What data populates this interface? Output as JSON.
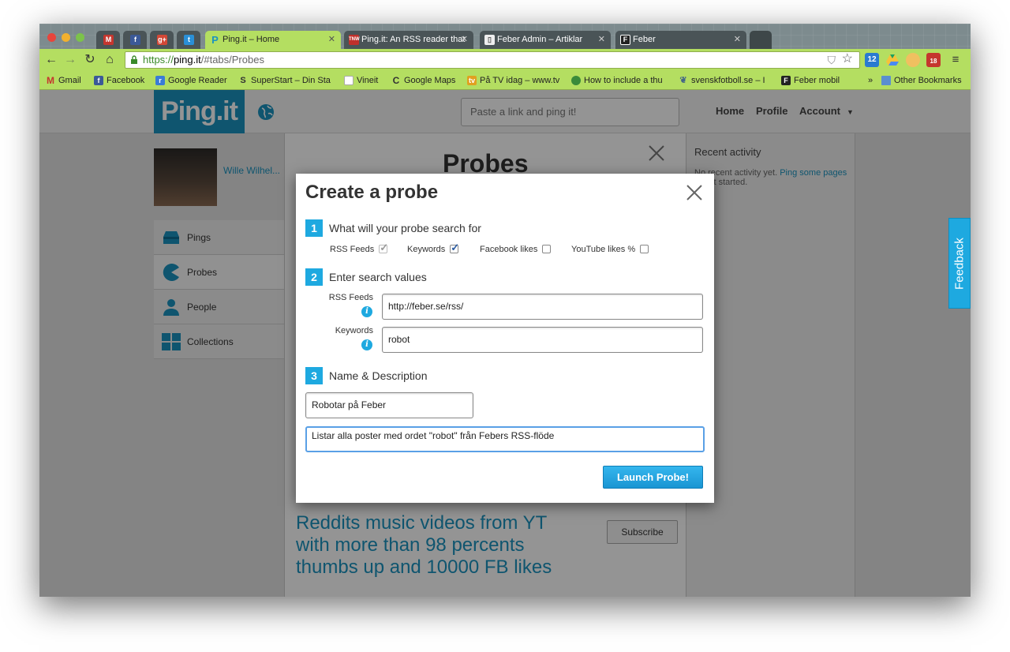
{
  "browser": {
    "tabs": [
      {
        "label": "",
        "icon": "gmail-icon",
        "color": "#c5362e"
      },
      {
        "label": "",
        "icon": "facebook-icon",
        "color": "#3b5998"
      },
      {
        "label": "",
        "icon": "google-plus-icon",
        "color": "#d34836"
      },
      {
        "label": "",
        "icon": "twitter-icon",
        "color": "#2a8fd6"
      },
      {
        "label": "Ping.it – Home",
        "icon": "pingit-icon",
        "color": "#1b93bf"
      },
      {
        "label": "Ping.it: An RSS reader that",
        "icon": "tnw-icon",
        "color": "#c0302b"
      },
      {
        "label": "Feber Admin – Artiklar",
        "icon": "document-icon",
        "color": "#eeeeee"
      },
      {
        "label": "Feber",
        "icon": "feber-icon",
        "color": "#222222"
      }
    ],
    "url_prefix": "https://",
    "url_host": "ping.it",
    "url_path": "/#tabs/Probes",
    "bookmarks": [
      {
        "label": "Gmail",
        "color": "#c5362e"
      },
      {
        "label": "Facebook",
        "color": "#3b5998"
      },
      {
        "label": "Google Reader",
        "color": "#3a7cd6"
      },
      {
        "label": "SuperStart – Din Sta",
        "color": "#333333"
      },
      {
        "label": "Vineit",
        "color": "#dddddd"
      },
      {
        "label": "Google Maps",
        "color": "#4a8a3a"
      },
      {
        "label": "På TV idag – www.tv",
        "color": "#e0a020"
      },
      {
        "label": "How to include a thu",
        "color": "#3a8a3a"
      },
      {
        "label": "svenskfotboll.se – I",
        "color": "#446688"
      },
      {
        "label": "Feber mobil",
        "color": "#222222"
      },
      {
        "label": "Other Bookmarks",
        "color": "#5a8fd0"
      }
    ],
    "bookmarks_overflow": "»",
    "extensions_badge": "12",
    "mail_badge": "18"
  },
  "header": {
    "logo": "Ping.it",
    "search_placeholder": "Paste a link and ping it!",
    "nav": [
      "Home",
      "Profile",
      "Account"
    ]
  },
  "sidebar": {
    "username": "Wille Wilhel...",
    "items": [
      "Pings",
      "Probes",
      "People",
      "Collections"
    ]
  },
  "main": {
    "title": "Probes",
    "probe_title": "Reddits music videos from YT with more than 98 percents thumbs up and 10000 FB likes",
    "subscribe_label": "Subscribe"
  },
  "recent": {
    "title": "Recent activity",
    "text_before": "No recent activity yet.",
    "link": "Ping some pages",
    "text_after": "to get started."
  },
  "feedback_label": "Feedback",
  "modal": {
    "title": "Create a probe",
    "step1": {
      "num": "1",
      "label": "What will your probe search for"
    },
    "options": [
      {
        "label": "RSS Feeds",
        "checked": true,
        "disabled": true
      },
      {
        "label": "Keywords",
        "checked": true,
        "disabled": false
      },
      {
        "label": "Facebook likes",
        "checked": false,
        "disabled": false
      },
      {
        "label": "YouTube likes %",
        "checked": false,
        "disabled": false
      }
    ],
    "step2": {
      "num": "2",
      "label": "Enter search values"
    },
    "rss_label": "RSS Feeds",
    "rss_value": "http://feber.se/rss/",
    "keywords_label": "Keywords",
    "keywords_value": "robot",
    "step3": {
      "num": "3",
      "label": "Name & Description"
    },
    "name_value": "Robotar på Feber",
    "description_value": "Listar alla poster med ordet \"robot\" från Febers RSS-flöde",
    "launch_label": "Launch Probe!"
  }
}
